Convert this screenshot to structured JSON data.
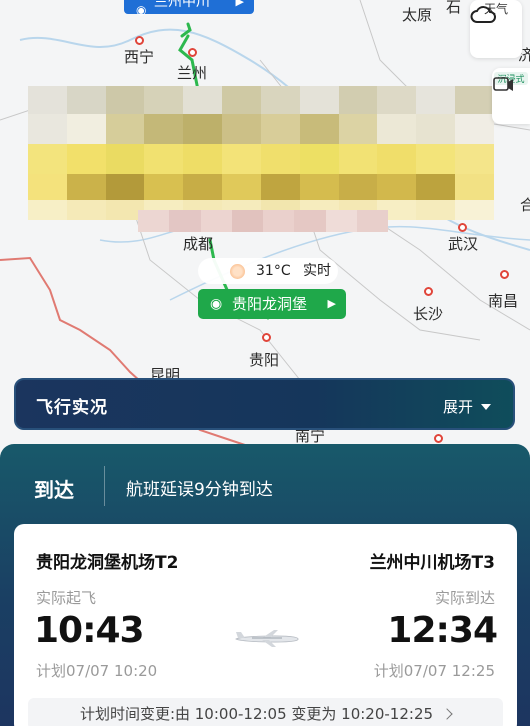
{
  "map": {
    "origin_label": "兰州中川",
    "cities": [
      {
        "name": "西宁"
      },
      {
        "name": "兰州"
      },
      {
        "name": "太原"
      },
      {
        "name": "石"
      },
      {
        "name": "成都"
      },
      {
        "name": "武汉"
      },
      {
        "name": "长沙"
      },
      {
        "name": "南昌"
      },
      {
        "name": "贵阳"
      },
      {
        "name": "昆明"
      },
      {
        "name": "南宁"
      },
      {
        "name": "济"
      },
      {
        "name": "合"
      }
    ],
    "weather_button": "天气",
    "immersive_button": "沉浸式",
    "weather_chip": {
      "temp": "31°C",
      "label": "实时"
    },
    "destination_label": "贵阳龙洞堡"
  },
  "status_bar": {
    "title": "飞行实况",
    "expand": "展开"
  },
  "panel": {
    "state": "到达",
    "message": "航班延误9分钟到达",
    "departure": {
      "airport": "贵阳龙洞堡机场T2",
      "label": "实际起飞",
      "time": "10:43",
      "planned": "计划07/07 10:20"
    },
    "arrival": {
      "airport": "兰州中川机场T3",
      "label": "实际到达",
      "time": "12:34",
      "planned": "计划07/07 12:25"
    },
    "notice": "计划时间变更:由 10:00-12:05 变更为 10:20-12:25"
  },
  "colors": {
    "route": "#2db84e",
    "origin_pill": "#1f6fd6",
    "dest_pill": "#1fa84a",
    "border": "#e0453a"
  }
}
